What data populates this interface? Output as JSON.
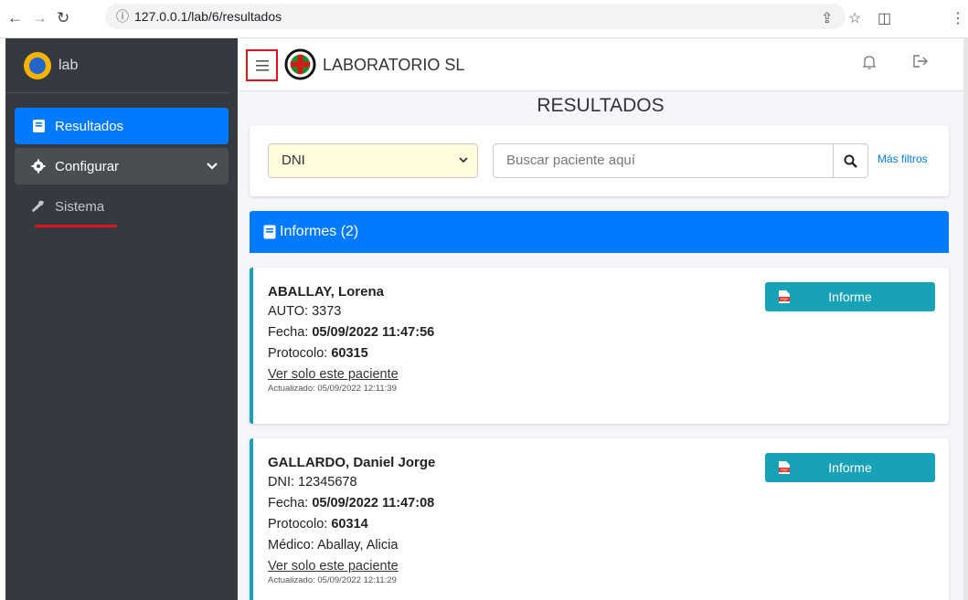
{
  "browser": {
    "url": "127.0.0.1/lab/6/resultados"
  },
  "sidebar": {
    "brand": "lab",
    "items": [
      {
        "label": "Resultados",
        "icon": "book-icon",
        "state": "active"
      },
      {
        "label": "Configurar",
        "icon": "gear-icon",
        "state": "expandable"
      },
      {
        "label": "Sistema",
        "icon": "tools-icon",
        "state": "normal"
      }
    ]
  },
  "header": {
    "lab_name": "LABORATORIO SL"
  },
  "page": {
    "title": "RESULTADOS"
  },
  "filters": {
    "doc_type": "DNI",
    "search_placeholder": "Buscar paciente aquí",
    "more_filters": "Más filtros"
  },
  "informes": {
    "header": "Informes (2)",
    "items": [
      {
        "name": "ABALLAY, Lorena",
        "id_line": "AUTO: 3373",
        "fecha_label": "Fecha: ",
        "fecha": "05/09/2022  11:47:56",
        "protocolo_label": "Protocolo: ",
        "protocolo": "60315",
        "link": "Ver solo este paciente",
        "updated": "Actualizado: 05/09/2022 12:11:39",
        "button": "Informe"
      },
      {
        "name": "GALLARDO, Daniel Jorge",
        "id_line": "DNI: 12345678",
        "fecha_label": "Fecha: ",
        "fecha": "05/09/2022  11:47:08",
        "protocolo_label": "Protocolo: ",
        "protocolo": "60314",
        "medico": "Médico: Aballay, Alicia",
        "link": "Ver solo este paciente",
        "updated": "Actualizado: 05/09/2022 12:11:29",
        "button": "Informe"
      }
    ]
  },
  "colors": {
    "primary": "#007bff",
    "info": "#17a2b8",
    "sidebar": "#343a40",
    "highlight": "#e0151b"
  }
}
